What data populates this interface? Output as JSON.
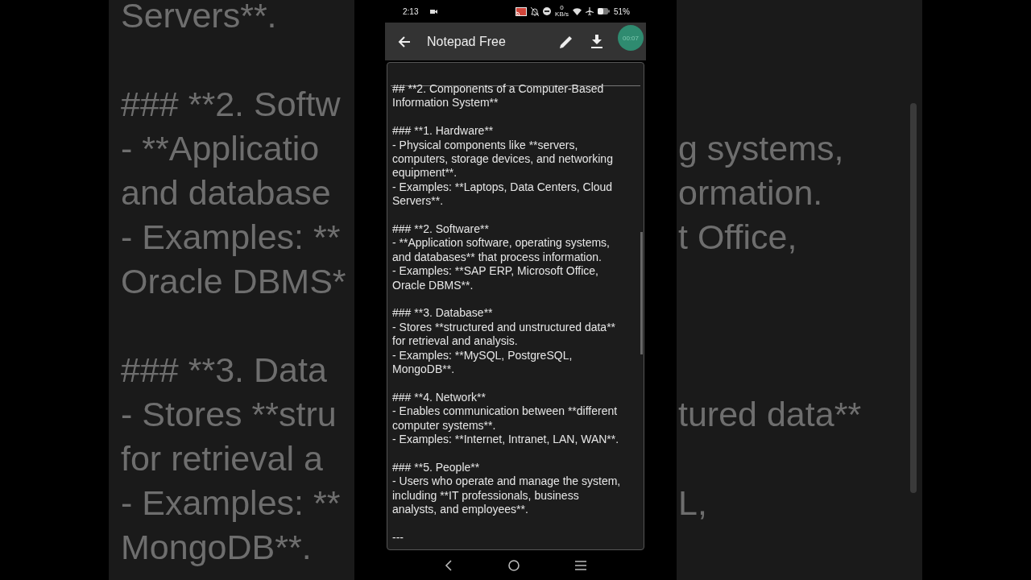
{
  "backdrop": {
    "paragraphs": [
      [
        {
          "left": "Servers**."
        }
      ],
      [
        {
          "left": "### **2. Softw"
        },
        {
          "left": "- **Applicatio",
          "right": "g systems,"
        },
        {
          "left": "and database",
          "right": "ormation."
        },
        {
          "left": "- Examples: **",
          "right": "t Office,"
        },
        {
          "left": "Oracle DBMS*"
        }
      ],
      [
        {
          "left": "### **3. Data"
        },
        {
          "left": "- Stores **stru",
          "right": "tured data**"
        },
        {
          "left": "for retrieval a"
        },
        {
          "left": "- Examples: **",
          "right": "L,"
        },
        {
          "left": "MongoDB**."
        }
      ]
    ]
  },
  "status_bar": {
    "time": "2:13",
    "net_speed_value": "0",
    "net_speed_unit": "KB/s",
    "battery": "51%"
  },
  "toolbar": {
    "title": "Notepad Free"
  },
  "recording_timer": "00:07",
  "note": {
    "paragraphs": [
      [
        "## **2. Components of a Computer-Based",
        "Information System**"
      ],
      [
        "### **1. Hardware**",
        "- Physical components like **servers,",
        "computers, storage devices, and networking",
        "equipment**.",
        "- Examples: **Laptops, Data Centers, Cloud",
        "Servers**."
      ],
      [
        "### **2. Software**",
        "- **Application software, operating systems,",
        "and databases** that process information.",
        "- Examples: **SAP ERP, Microsoft Office,",
        "Oracle DBMS**."
      ],
      [
        "### **3. Database**",
        "- Stores **structured and unstructured data**",
        "for retrieval and analysis.",
        "- Examples: **MySQL, PostgreSQL,",
        "MongoDB**."
      ],
      [
        "### **4. Network**",
        "- Enables communication between **different",
        "computer systems**.",
        "- Examples: **Internet, Intranet, LAN, WAN**."
      ],
      [
        "### **5. People**",
        "- Users who operate and manage the system,",
        "including **IT professionals, business",
        "analysts, and employees**."
      ],
      [
        "---"
      ]
    ]
  }
}
